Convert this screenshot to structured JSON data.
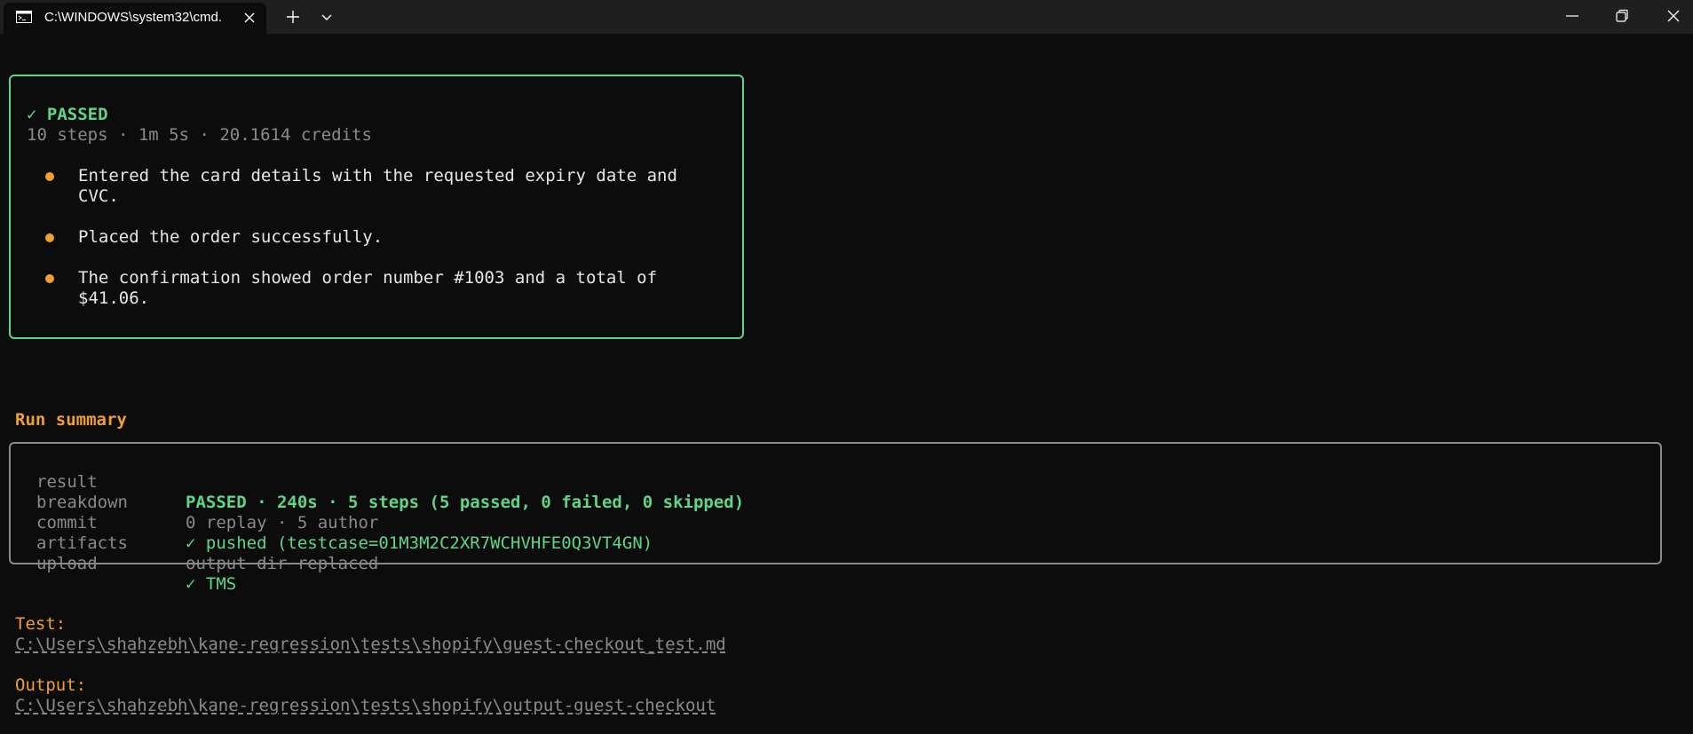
{
  "window": {
    "tab_title": "C:\\WINDOWS\\system32\\cmd.",
    "icons": {
      "tab_icon": "terminal-icon",
      "tab_close": "close-icon",
      "new_tab": "plus-icon",
      "dropdown": "chevron-down-icon",
      "minimize": "minimize-icon",
      "maximize": "restore-icon",
      "close": "close-icon"
    }
  },
  "result_card": {
    "status": "✓ PASSED",
    "meta": "10 steps · 1m 5s · 20.1614 credits",
    "bullets": [
      "Entered the card details with the requested expiry date and CVC.",
      "Placed the order successfully.",
      "The confirmation showed order number #1003 and a total of $41.06."
    ]
  },
  "run_summary": {
    "heading": "Run summary",
    "rows": [
      {
        "key": "result",
        "value": "PASSED · 240s · 5 steps (5 passed, 0 failed, 0 skipped)"
      },
      {
        "key": "breakdown",
        "value": "0 replay · 5 author"
      },
      {
        "key": "commit",
        "value": "✓ pushed (testcase=01M3M2C2XR7WCHVHFE0Q3VT4GN)"
      },
      {
        "key": "artifacts",
        "value": "output dir replaced"
      },
      {
        "key": "upload",
        "value": "✓ TMS"
      }
    ]
  },
  "paths": {
    "test_label": "Test:",
    "test_value": "C:\\Users\\shahzebh\\kane-regression\\tests\\shopify\\guest-checkout_test.md",
    "output_label": "Output:",
    "output_value": "C:\\Users\\shahzebh\\kane-regression\\tests\\shopify\\output-guest-checkout"
  },
  "colors": {
    "background": "#0c0c0c",
    "titlebar": "#1f1f1f",
    "success": "#5fd687",
    "accent": "#f0a030",
    "dim": "#8a8a8a"
  }
}
